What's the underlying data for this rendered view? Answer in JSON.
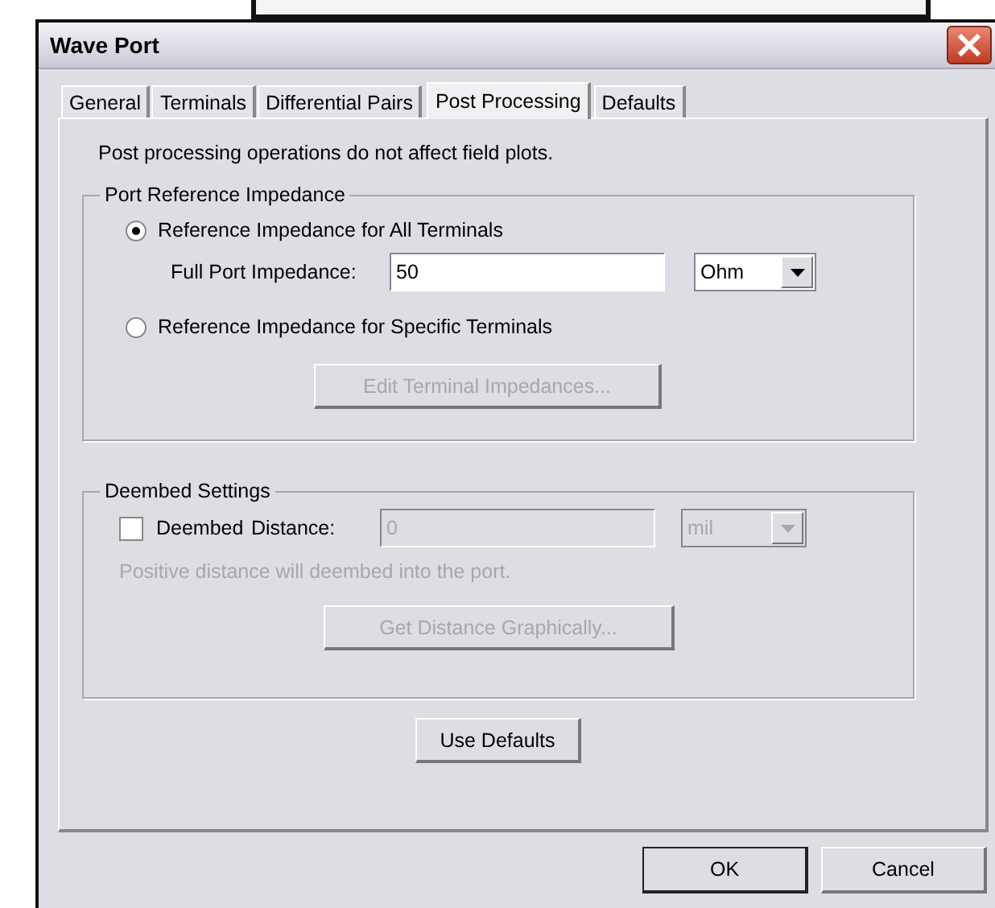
{
  "window": {
    "title": "Wave Port"
  },
  "tabs": [
    {
      "label": "General",
      "selected": false
    },
    {
      "label": "Terminals",
      "selected": false
    },
    {
      "label": "Differential Pairs",
      "selected": false
    },
    {
      "label": "Post Processing",
      "selected": true
    },
    {
      "label": "Defaults",
      "selected": false
    }
  ],
  "note": "Post processing operations do not affect field plots.",
  "port_reference_impedance": {
    "title": "Port Reference Impedance",
    "options": [
      {
        "label": "Reference Impedance for All Terminals",
        "selected": true
      },
      {
        "label": "Reference Impedance for Specific Terminals",
        "selected": false
      }
    ],
    "full_port_impedance": {
      "label": "Full Port Impedance:",
      "value": "50",
      "unit": "Ohm"
    },
    "edit_button": {
      "label": "Edit Terminal Impedances...",
      "disabled": true
    }
  },
  "deembed_settings": {
    "title": "Deembed Settings",
    "deembed": {
      "label": "Deembed",
      "checked": false
    },
    "distance": {
      "label": "Distance:",
      "value": "0",
      "unit": "mil",
      "disabled": true
    },
    "hint": {
      "text": "Positive distance will deembed into the port.",
      "disabled": true
    },
    "get_distance_button": {
      "label": "Get Distance Graphically...",
      "disabled": true
    }
  },
  "use_defaults_button": "Use Defaults",
  "buttons": [
    "OK",
    "Cancel"
  ]
}
